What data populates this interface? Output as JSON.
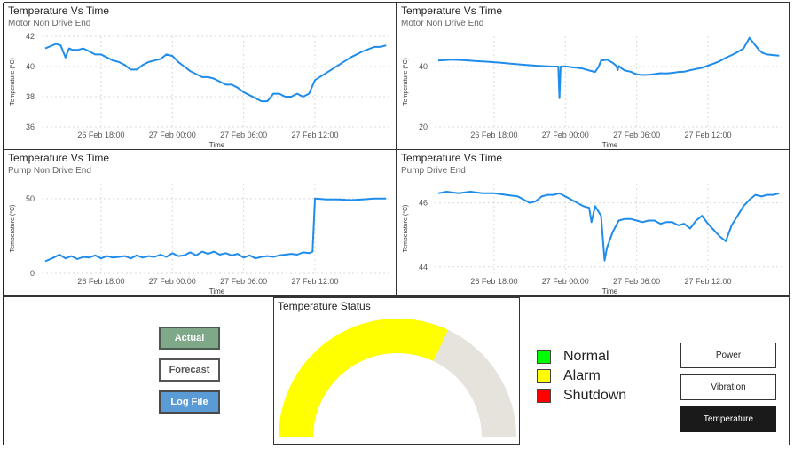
{
  "charts": [
    {
      "title": "Temperature Vs Time",
      "subtitle": "Motor Non Drive End",
      "xlabel": "Time",
      "ylabel": "Temperature (°C)"
    },
    {
      "title": "Temperature Vs Time",
      "subtitle": "Motor Non Drive End",
      "xlabel": "Time",
      "ylabel": "Temperature (°C)"
    },
    {
      "title": "Temperature Vs Time",
      "subtitle": "Pump Non Drive End",
      "xlabel": "Time",
      "ylabel": "Temperature (°C)"
    },
    {
      "title": "Temperature Vs Time",
      "subtitle": "Pump Drive End",
      "xlabel": "Time",
      "ylabel": "Temperature (°C)"
    }
  ],
  "chart_data": [
    {
      "type": "line",
      "title": "Temperature Vs Time",
      "subtitle": "Motor Non Drive End",
      "xlabel": "Time",
      "ylabel": "Temperature (°C)",
      "x_ticks": [
        "26 Feb 18:00",
        "27 Feb 00:00",
        "27 Feb 06:00",
        "27 Feb 12:00"
      ],
      "x_tick_hours": [
        18,
        24,
        30,
        36
      ],
      "xlim_hours": [
        13,
        42.5
      ],
      "y_ticks": [
        36,
        38,
        40,
        42
      ],
      "ylim": [
        36,
        42
      ],
      "grid": true,
      "color": "#1f8ceb",
      "series": [
        {
          "x_hours": [
            13.3,
            14.2,
            14.6,
            15.0,
            15.3,
            15.6,
            16.0,
            16.5,
            17.0,
            17.5,
            18.0,
            18.5,
            19.0,
            19.5,
            20.0,
            20.5,
            21.0,
            21.5,
            22.0,
            22.5,
            23.0,
            23.5,
            24.0,
            24.5,
            25.0,
            25.5,
            26.0,
            26.5,
            27.0,
            27.5,
            28.0,
            28.5,
            29.0,
            29.5,
            30.0,
            30.5,
            31.0,
            31.5,
            32.0,
            32.5,
            33.0,
            33.5,
            34.0,
            34.5,
            35.0,
            35.5,
            36.0,
            37.0,
            38.0,
            39.0,
            40.0,
            41.0,
            41.5,
            42.0
          ],
          "y": [
            41.2,
            41.5,
            41.4,
            40.6,
            41.2,
            41.1,
            41.1,
            41.2,
            41.0,
            40.8,
            40.8,
            40.6,
            40.4,
            40.3,
            40.1,
            39.8,
            39.8,
            40.1,
            40.3,
            40.4,
            40.5,
            40.8,
            40.7,
            40.3,
            40.0,
            39.7,
            39.5,
            39.3,
            39.3,
            39.2,
            39.0,
            38.8,
            38.8,
            38.6,
            38.3,
            38.1,
            37.9,
            37.7,
            37.7,
            38.2,
            38.2,
            38.0,
            38.0,
            38.2,
            38.0,
            38.2,
            39.1,
            39.6,
            40.1,
            40.6,
            41.0,
            41.3,
            41.3,
            41.4
          ]
        }
      ]
    },
    {
      "type": "line",
      "title": "Temperature Vs Time",
      "subtitle": "Motor Non Drive End",
      "xlabel": "Time",
      "ylabel": "Temperature (°C)",
      "x_ticks": [
        "26 Feb 18:00",
        "27 Feb 00:00",
        "27 Feb 06:00",
        "27 Feb 12:00"
      ],
      "x_tick_hours": [
        18,
        24,
        30,
        36
      ],
      "xlim_hours": [
        13,
        42.5
      ],
      "y_ticks": [
        20,
        40
      ],
      "ylim": [
        20,
        50
      ],
      "grid": true,
      "color": "#1f8ceb",
      "series": [
        {
          "x_hours": [
            13.3,
            14.5,
            15.5,
            16.5,
            17.5,
            18.5,
            19.5,
            20.5,
            21.5,
            22.5,
            23.0,
            23.4,
            23.5,
            23.6,
            24.0,
            24.5,
            25.0,
            25.5,
            26.0,
            26.5,
            26.8,
            27.0,
            27.5,
            28.0,
            28.3,
            28.4,
            28.5,
            28.7,
            29.0,
            29.5,
            30.0,
            30.5,
            31.0,
            31.5,
            32.0,
            32.5,
            33.0,
            33.5,
            34.0,
            34.5,
            35.0,
            35.5,
            36.0,
            36.5,
            37.0,
            37.5,
            38.0,
            38.5,
            39.0,
            39.5,
            40.0,
            40.3,
            40.6,
            41.0,
            41.5,
            42.0
          ],
          "y": [
            42.0,
            42.3,
            42.1,
            41.8,
            41.6,
            41.3,
            40.9,
            40.6,
            40.3,
            40.1,
            40.0,
            40.0,
            29.5,
            40.0,
            40.1,
            39.8,
            39.6,
            39.3,
            38.7,
            38.2,
            40.0,
            42.0,
            42.3,
            41.2,
            40.2,
            38.8,
            40.2,
            39.5,
            38.7,
            38.3,
            37.4,
            37.2,
            37.3,
            37.5,
            37.8,
            37.7,
            37.9,
            38.2,
            38.3,
            38.8,
            39.2,
            39.6,
            40.3,
            41.0,
            41.8,
            42.9,
            43.8,
            44.8,
            46.0,
            49.5,
            47.0,
            45.5,
            44.5,
            44.0,
            43.8,
            43.6
          ]
        }
      ]
    },
    {
      "type": "line",
      "title": "Temperature Vs Time",
      "subtitle": "Pump Non Drive End",
      "xlabel": "Time",
      "ylabel": "Temperature (°C)",
      "x_ticks": [
        "26 Feb 18:00",
        "27 Feb 00:00",
        "27 Feb 06:00",
        "27 Feb 12:00"
      ],
      "x_tick_hours": [
        18,
        24,
        30,
        36
      ],
      "xlim_hours": [
        13,
        42.5
      ],
      "y_ticks": [
        0,
        50
      ],
      "ylim": [
        0,
        60
      ],
      "grid": true,
      "color": "#1f8ceb",
      "series": [
        {
          "x_hours": [
            13.3,
            14.0,
            14.5,
            15.0,
            15.5,
            16.0,
            16.5,
            17.0,
            17.5,
            18.0,
            18.5,
            19.0,
            19.5,
            20.0,
            20.5,
            21.0,
            21.5,
            22.0,
            22.5,
            23.0,
            23.5,
            24.0,
            24.5,
            25.0,
            25.5,
            26.0,
            26.5,
            27.0,
            27.5,
            28.0,
            28.5,
            29.0,
            29.5,
            30.0,
            30.5,
            31.0,
            31.5,
            32.0,
            32.5,
            33.0,
            33.5,
            34.0,
            34.5,
            35.0,
            35.5,
            35.8,
            36.0,
            37.0,
            38.0,
            39.0,
            40.0,
            41.0,
            42.0
          ],
          "y": [
            8.0,
            10.5,
            12.5,
            10.0,
            11.5,
            9.5,
            11.0,
            10.5,
            12.0,
            10.0,
            11.5,
            10.5,
            11.0,
            11.5,
            10.0,
            12.0,
            10.5,
            11.5,
            11.0,
            12.5,
            11.0,
            13.5,
            11.5,
            12.0,
            14.0,
            12.0,
            14.5,
            13.0,
            14.5,
            12.5,
            13.5,
            12.0,
            13.0,
            10.5,
            12.0,
            10.0,
            11.0,
            11.5,
            11.0,
            12.0,
            12.5,
            13.0,
            12.5,
            14.0,
            13.5,
            14.5,
            50.0,
            49.5,
            49.5,
            49.0,
            49.5,
            50.0,
            50.0
          ]
        }
      ]
    },
    {
      "type": "line",
      "title": "Temperature Vs Time",
      "subtitle": "Pump Drive End",
      "xlabel": "Time",
      "ylabel": "Temperature (°C)",
      "x_ticks": [
        "26 Feb 18:00",
        "27 Feb 00:00",
        "27 Feb 06:00",
        "27 Feb 12:00"
      ],
      "x_tick_hours": [
        18,
        24,
        30,
        36
      ],
      "xlim_hours": [
        13,
        42.5
      ],
      "y_ticks": [
        44,
        46
      ],
      "ylim": [
        43.8,
        46.6
      ],
      "grid": true,
      "color": "#1f8ceb",
      "series": [
        {
          "x_hours": [
            13.3,
            14.0,
            15.0,
            16.0,
            17.0,
            18.0,
            19.0,
            20.0,
            20.5,
            21.0,
            21.5,
            22.0,
            22.5,
            23.0,
            23.5,
            24.0,
            24.5,
            25.0,
            25.5,
            26.0,
            26.2,
            26.5,
            27.0,
            27.3,
            27.5,
            28.0,
            28.5,
            29.0,
            29.5,
            30.0,
            30.5,
            31.0,
            31.5,
            32.0,
            32.5,
            33.0,
            33.5,
            34.0,
            34.5,
            35.0,
            35.5,
            36.0,
            36.5,
            37.0,
            37.5,
            38.0,
            38.5,
            39.0,
            39.5,
            40.0,
            40.5,
            41.0,
            41.5,
            42.0
          ],
          "y": [
            46.3,
            46.35,
            46.3,
            46.35,
            46.3,
            46.3,
            46.25,
            46.2,
            46.1,
            46.0,
            46.05,
            46.2,
            46.25,
            46.25,
            46.3,
            46.2,
            46.1,
            46.0,
            45.9,
            45.85,
            45.4,
            45.9,
            45.6,
            44.2,
            44.6,
            45.1,
            45.45,
            45.5,
            45.5,
            45.45,
            45.4,
            45.45,
            45.45,
            45.35,
            45.4,
            45.4,
            45.3,
            45.35,
            45.2,
            45.45,
            45.6,
            45.35,
            45.15,
            44.95,
            44.8,
            45.3,
            45.6,
            45.9,
            46.1,
            46.25,
            46.2,
            46.25,
            46.25,
            46.3
          ]
        }
      ]
    }
  ],
  "buttons": {
    "actual": "Actual",
    "forecast": "Forecast",
    "log_file": "Log File",
    "actual_color": "#7fa889",
    "log_file_color": "#5b9bd5"
  },
  "gauge": {
    "title": "Temperature Status",
    "fraction": 0.64,
    "fill_color": "#ffff00",
    "track_color": "#e6e2dc"
  },
  "legend": [
    {
      "label": "Normal",
      "color": "#00ff00"
    },
    {
      "label": "Alarm",
      "color": "#ffff00"
    },
    {
      "label": "Shutdown",
      "color": "#ff0000"
    }
  ],
  "nav": {
    "power": "Power",
    "vibration": "Vibration",
    "temperature": "Temperature"
  }
}
